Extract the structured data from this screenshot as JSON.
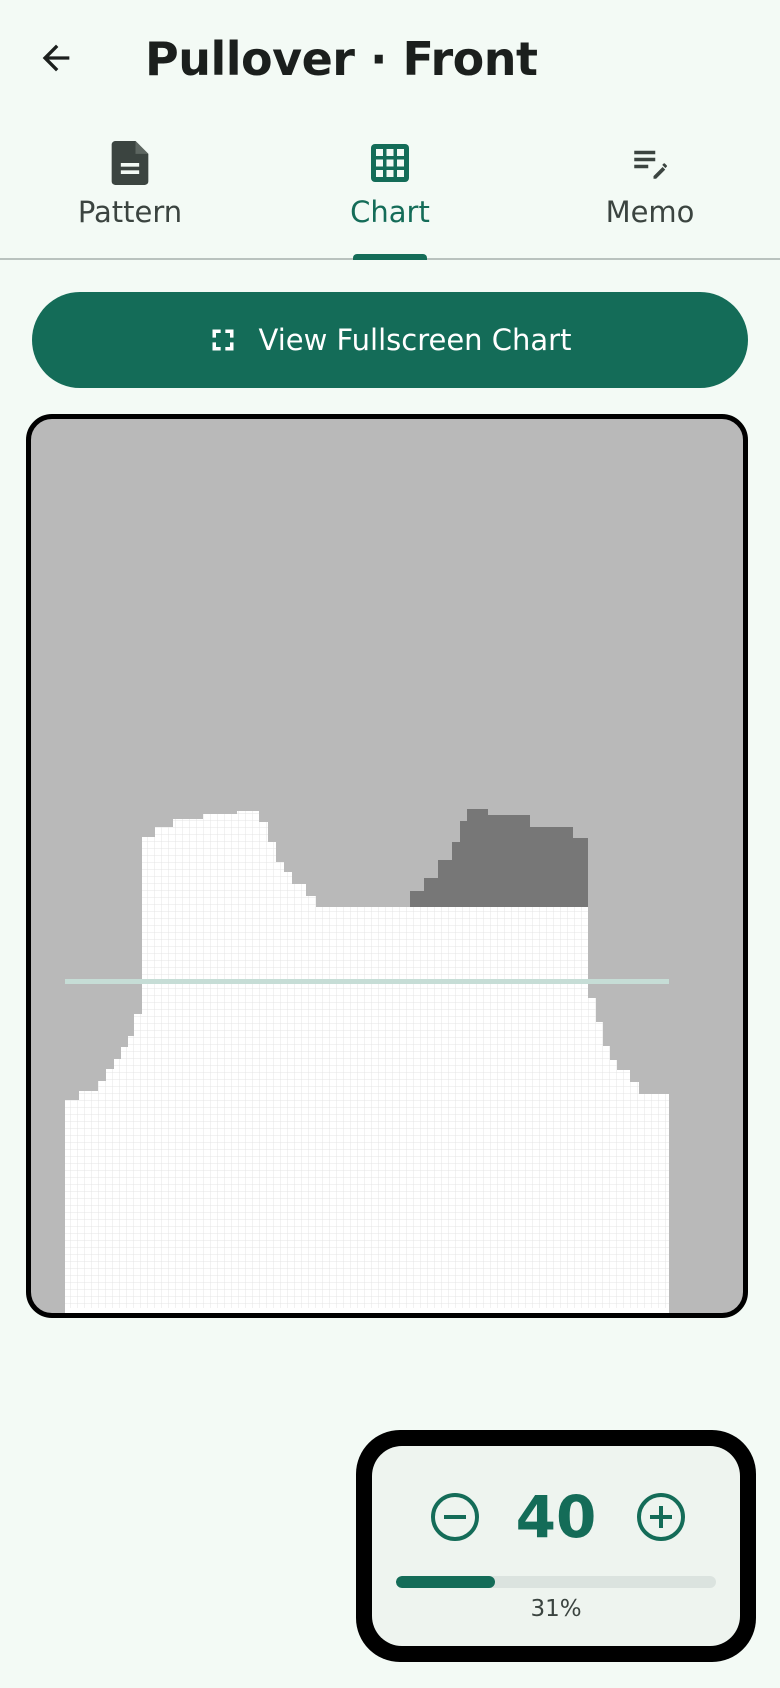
{
  "header": {
    "back_icon": "arrow-left-icon",
    "title": "Pullover · Front"
  },
  "tabs": [
    {
      "label": "Pattern",
      "icon": "document-icon",
      "active": false
    },
    {
      "label": "Chart",
      "icon": "grid-icon",
      "active": true
    },
    {
      "label": "Memo",
      "icon": "edit-notes-icon",
      "active": false
    }
  ],
  "fullscreen_button": {
    "label": "View Fullscreen Chart",
    "icon": "fullscreen-icon"
  },
  "counter": {
    "value": "40",
    "percent_label": "31%",
    "progress": 0.31,
    "minus_icon": "minus-circle-icon",
    "plus_icon": "plus-circle-icon"
  },
  "colors": {
    "accent": "#146c58",
    "chart_background": "#b9b9b9",
    "row_highlight": "#c6ddd6",
    "filled_stitches": "#777777"
  }
}
